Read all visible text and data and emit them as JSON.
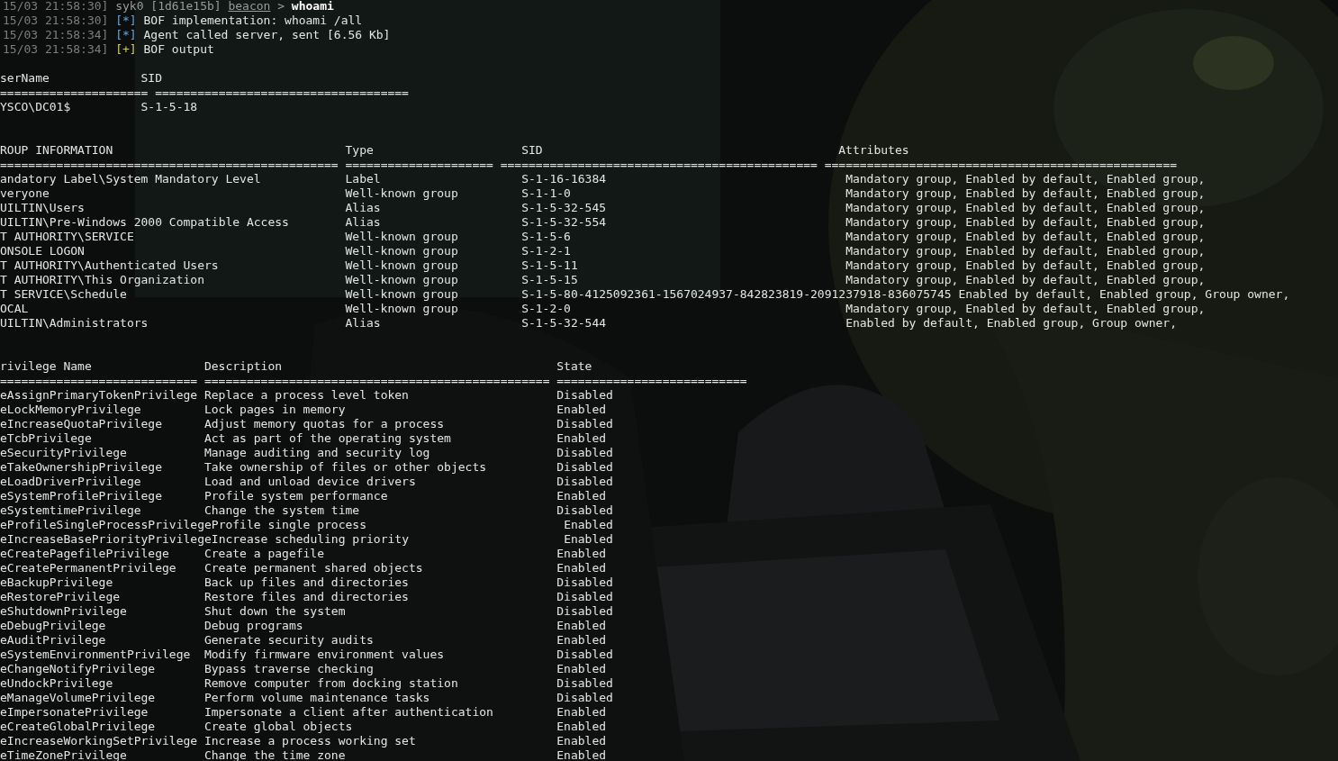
{
  "log": [
    {
      "timestamp": "15/03 21:58:30]",
      "kind": "prompt",
      "user": "syk0",
      "session": "[1d61e15b]",
      "module": "beacon",
      "arrow": ">",
      "command": "whoami"
    },
    {
      "timestamp": "15/03 21:58:30]",
      "kind": "info",
      "tag": "[*]",
      "text": "BOF implementation: whoami /all"
    },
    {
      "timestamp": "15/03 21:58:34]",
      "kind": "info",
      "tag": "[*]",
      "text": "Agent called server, sent [6.56 Kb]"
    },
    {
      "timestamp": "15/03 21:58:34]",
      "kind": "success",
      "tag": "[+]",
      "text": "BOF output"
    }
  ],
  "user_table": {
    "columns": [
      "serName",
      "SID"
    ],
    "separators": [
      "=====================",
      "===================================="
    ],
    "rows": [
      [
        "YSCO\\DC01$",
        "S-1-5-18"
      ]
    ]
  },
  "group_table": {
    "columns": [
      "ROUP INFORMATION",
      "Type",
      "SID",
      "Attributes"
    ],
    "separators": [
      "================================================",
      "=====================",
      "=============================================",
      "=================================================="
    ],
    "rows": [
      [
        "andatory Label\\System Mandatory Level",
        "Label",
        "S-1-16-16384",
        "Mandatory group, Enabled by default, Enabled group,"
      ],
      [
        "veryone",
        "Well-known group",
        "S-1-1-0",
        "Mandatory group, Enabled by default, Enabled group,"
      ],
      [
        "UILTIN\\Users",
        "Alias",
        "S-1-5-32-545",
        "Mandatory group, Enabled by default, Enabled group,"
      ],
      [
        "UILTIN\\Pre-Windows 2000 Compatible Access",
        "Alias",
        "S-1-5-32-554",
        "Mandatory group, Enabled by default, Enabled group,"
      ],
      [
        "T AUTHORITY\\SERVICE",
        "Well-known group",
        "S-1-5-6",
        "Mandatory group, Enabled by default, Enabled group,"
      ],
      [
        "ONSOLE LOGON",
        "Well-known group",
        "S-1-2-1",
        "Mandatory group, Enabled by default, Enabled group,"
      ],
      [
        "T AUTHORITY\\Authenticated Users",
        "Well-known group",
        "S-1-5-11",
        "Mandatory group, Enabled by default, Enabled group,"
      ],
      [
        "T AUTHORITY\\This Organization",
        "Well-known group",
        "S-1-5-15",
        "Mandatory group, Enabled by default, Enabled group,"
      ],
      [
        "T SERVICE\\Schedule",
        "Well-known group",
        "S-1-5-80-4125092361-1567024937-842823819-2091237918-836075745",
        "Enabled by default, Enabled group, Group owner,"
      ],
      [
        "OCAL",
        "Well-known group",
        "S-1-2-0",
        "Mandatory group, Enabled by default, Enabled group,"
      ],
      [
        "UILTIN\\Administrators",
        "Alias",
        "S-1-5-32-544",
        "Enabled by default, Enabled group, Group owner,"
      ]
    ]
  },
  "privilege_table": {
    "columns": [
      "rivilege Name",
      "Description",
      "State"
    ],
    "separators": [
      "============================",
      "=================================================",
      "==========================="
    ],
    "rows": [
      [
        "eAssignPrimaryTokenPrivilege",
        "Replace a process level token",
        "Disabled"
      ],
      [
        "eLockMemoryPrivilege",
        "Lock pages in memory",
        "Enabled"
      ],
      [
        "eIncreaseQuotaPrivilege",
        "Adjust memory quotas for a process",
        "Disabled"
      ],
      [
        "eTcbPrivilege",
        "Act as part of the operating system",
        "Enabled"
      ],
      [
        "eSecurityPrivilege",
        "Manage auditing and security log",
        "Disabled"
      ],
      [
        "eTakeOwnershipPrivilege",
        "Take ownership of files or other objects",
        "Disabled"
      ],
      [
        "eLoadDriverPrivilege",
        "Load and unload device drivers",
        "Disabled"
      ],
      [
        "eSystemProfilePrivilege",
        "Profile system performance",
        "Enabled"
      ],
      [
        "eSystemtimePrivilege",
        "Change the system time",
        "Disabled"
      ],
      [
        "eProfileSingleProcessPrivilege",
        "Profile single process",
        "Enabled"
      ],
      [
        "eIncreaseBasePriorityPrivilege",
        "Increase scheduling priority",
        "Enabled"
      ],
      [
        "eCreatePagefilePrivilege",
        "Create a pagefile",
        "Enabled"
      ],
      [
        "eCreatePermanentPrivilege",
        "Create permanent shared objects",
        "Enabled"
      ],
      [
        "eBackupPrivilege",
        "Back up files and directories",
        "Disabled"
      ],
      [
        "eRestorePrivilege",
        "Restore files and directories",
        "Disabled"
      ],
      [
        "eShutdownPrivilege",
        "Shut down the system",
        "Disabled"
      ],
      [
        "eDebugPrivilege",
        "Debug programs",
        "Enabled"
      ],
      [
        "eAuditPrivilege",
        "Generate security audits",
        "Enabled"
      ],
      [
        "eSystemEnvironmentPrivilege",
        "Modify firmware environment values",
        "Disabled"
      ],
      [
        "eChangeNotifyPrivilege",
        "Bypass traverse checking",
        "Enabled"
      ],
      [
        "eUndockPrivilege",
        "Remove computer from docking station",
        "Disabled"
      ],
      [
        "eManageVolumePrivilege",
        "Perform volume maintenance tasks",
        "Disabled"
      ],
      [
        "eImpersonatePrivilege",
        "Impersonate a client after authentication",
        "Enabled"
      ],
      [
        "eCreateGlobalPrivilege",
        "Create global objects",
        "Enabled"
      ],
      [
        "eIncreaseWorkingSetPrivilege",
        "Increase a process working set",
        "Enabled"
      ],
      [
        "eTimeZonePrivilege",
        "Change the time zone",
        "Enabled"
      ]
    ]
  }
}
